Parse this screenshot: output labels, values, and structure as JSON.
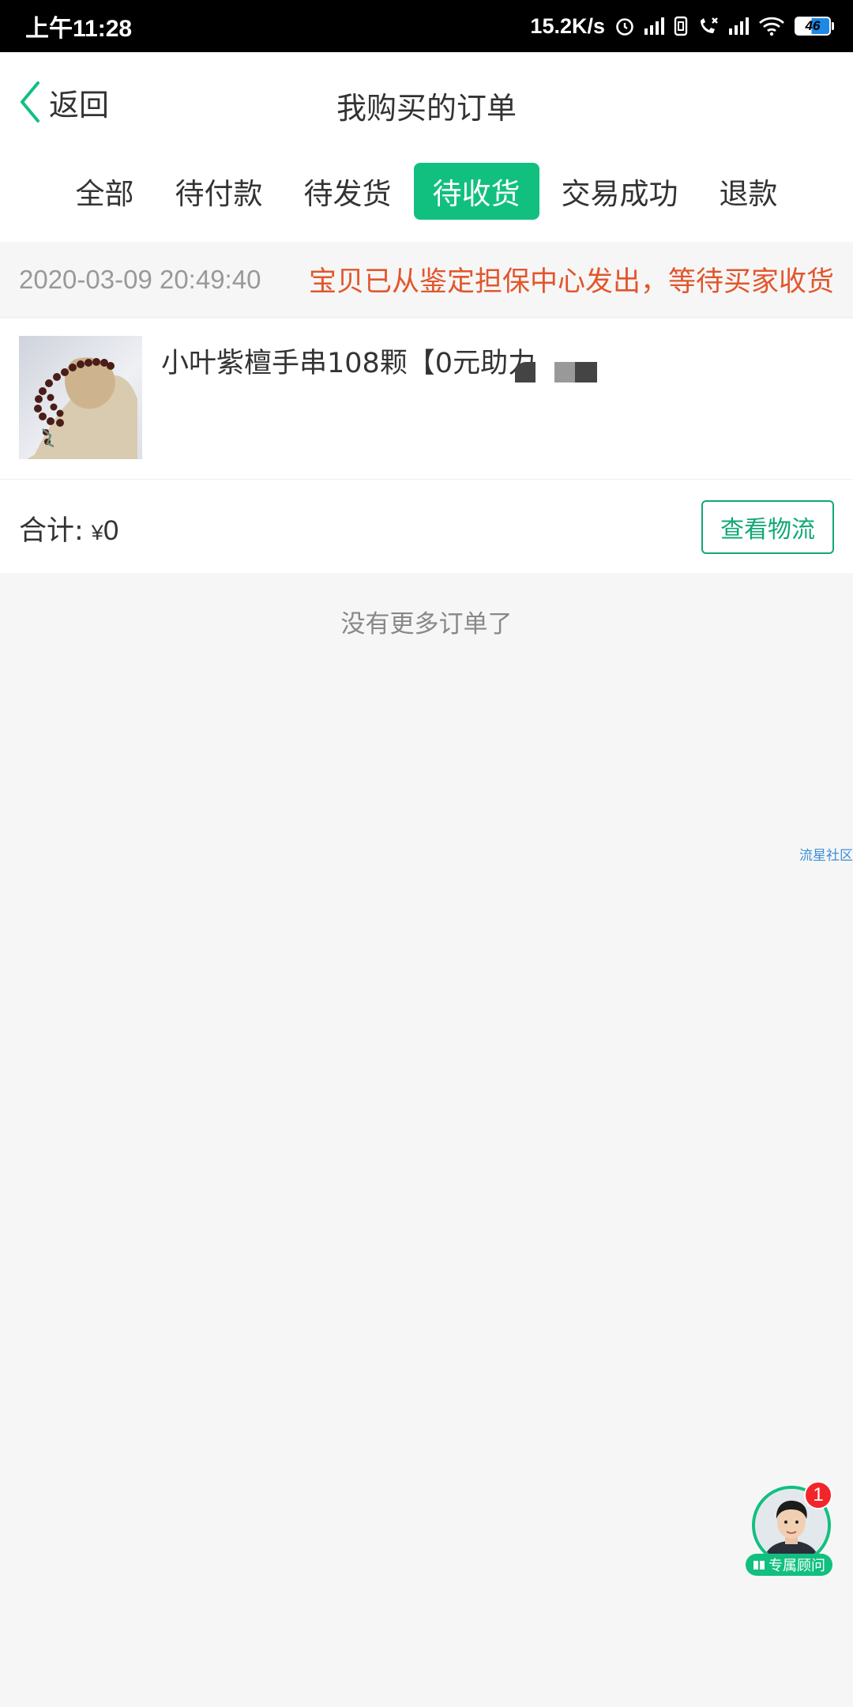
{
  "status_bar": {
    "time": "上午11:28",
    "speed": "15.2K/s",
    "battery": "46",
    "icons": [
      "alarm-icon",
      "signal-icon",
      "sim-icon",
      "call-blocked-icon",
      "signal-icon",
      "wifi-icon",
      "battery-icon"
    ]
  },
  "header": {
    "back_label": "返回",
    "title": "我购买的订单"
  },
  "tabs": [
    {
      "label": "全部",
      "active": false
    },
    {
      "label": "待付款",
      "active": false
    },
    {
      "label": "待发货",
      "active": false
    },
    {
      "label": "待收货",
      "active": true
    },
    {
      "label": "交易成功",
      "active": false
    },
    {
      "label": "退款",
      "active": false
    }
  ],
  "order": {
    "time": "2020-03-09 20:49:40",
    "status": "宝贝已从鉴定担保中心发出，等待买家收货",
    "item_name": "小叶紫檀手串108颗【0元助力",
    "total_label": "合计:",
    "total_currency": "¥",
    "total_amount": "0",
    "logistics_button": "查看物流"
  },
  "no_more_text": "没有更多订单了",
  "watermark": "流星社区",
  "advisor": {
    "badge_count": "1",
    "label": "专属顾问"
  },
  "colors": {
    "accent_green": "#11c07f",
    "status_red": "#e2562c",
    "badge_red": "#f2262a"
  }
}
